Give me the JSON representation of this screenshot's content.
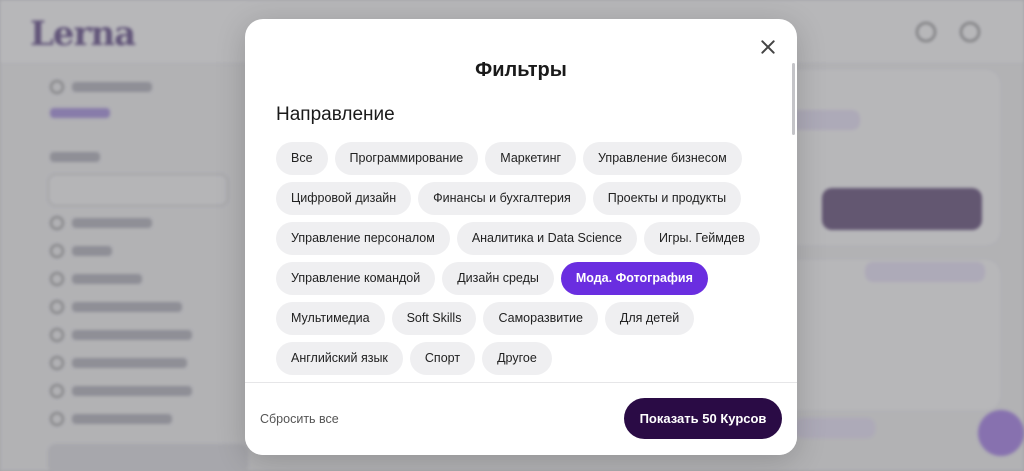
{
  "background": {
    "logo": "Lerna",
    "brand_color": "#2a0a5e",
    "accent_color": "#7b3fe4"
  },
  "modal": {
    "title": "Фильтры",
    "close_icon": "close-icon",
    "section": {
      "heading": "Направление",
      "chips": [
        {
          "label": "Все",
          "selected": false
        },
        {
          "label": "Программирование",
          "selected": false
        },
        {
          "label": "Маркетинг",
          "selected": false
        },
        {
          "label": "Управление бизнесом",
          "selected": false
        },
        {
          "label": "Цифровой дизайн",
          "selected": false
        },
        {
          "label": "Финансы и бухгалтерия",
          "selected": false
        },
        {
          "label": "Проекты и продукты",
          "selected": false
        },
        {
          "label": "Управление персоналом",
          "selected": false
        },
        {
          "label": "Аналитика и Data Science",
          "selected": false
        },
        {
          "label": "Игры. Геймдев",
          "selected": false
        },
        {
          "label": "Управление командой",
          "selected": false
        },
        {
          "label": "Дизайн среды",
          "selected": false
        },
        {
          "label": "Мода. Фотография",
          "selected": true
        },
        {
          "label": "Мультимедиа",
          "selected": false
        },
        {
          "label": "Soft Skills",
          "selected": false
        },
        {
          "label": "Саморазвитие",
          "selected": false
        },
        {
          "label": "Для детей",
          "selected": false
        },
        {
          "label": "Английский язык",
          "selected": false
        },
        {
          "label": "Спорт",
          "selected": false
        },
        {
          "label": "Другое",
          "selected": false
        }
      ]
    },
    "footer": {
      "reset_label": "Сбросить все",
      "show_button_label": "Показать 50 Курсов"
    },
    "colors": {
      "chip_selected": "#6a2ee0",
      "chip_default": "#efeff1",
      "show_button": "#2a0b45"
    }
  }
}
